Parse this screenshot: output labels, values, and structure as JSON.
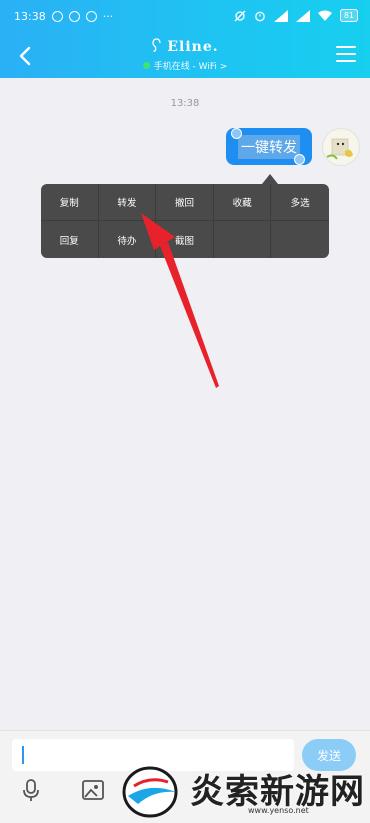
{
  "status_bar": {
    "time": "13:38",
    "more": "···",
    "battery": "81"
  },
  "header": {
    "title": "Eline.",
    "status": "手机在线 - WiFi >"
  },
  "chat": {
    "timestamp": "13:38",
    "message": "一键转发"
  },
  "context_menu": {
    "row1": [
      "复制",
      "转发",
      "撤回",
      "收藏",
      "多选"
    ],
    "row2": [
      "回复",
      "待办",
      "截图"
    ]
  },
  "input": {
    "send_label": "发送"
  },
  "watermark": {
    "text": "炎索新游网",
    "url": "www.yenso.net"
  },
  "colors": {
    "header": "#1fbcf3",
    "bubble": "#1e8ff1",
    "popup": "#4a4a4a",
    "arrow": "#e8222b"
  }
}
